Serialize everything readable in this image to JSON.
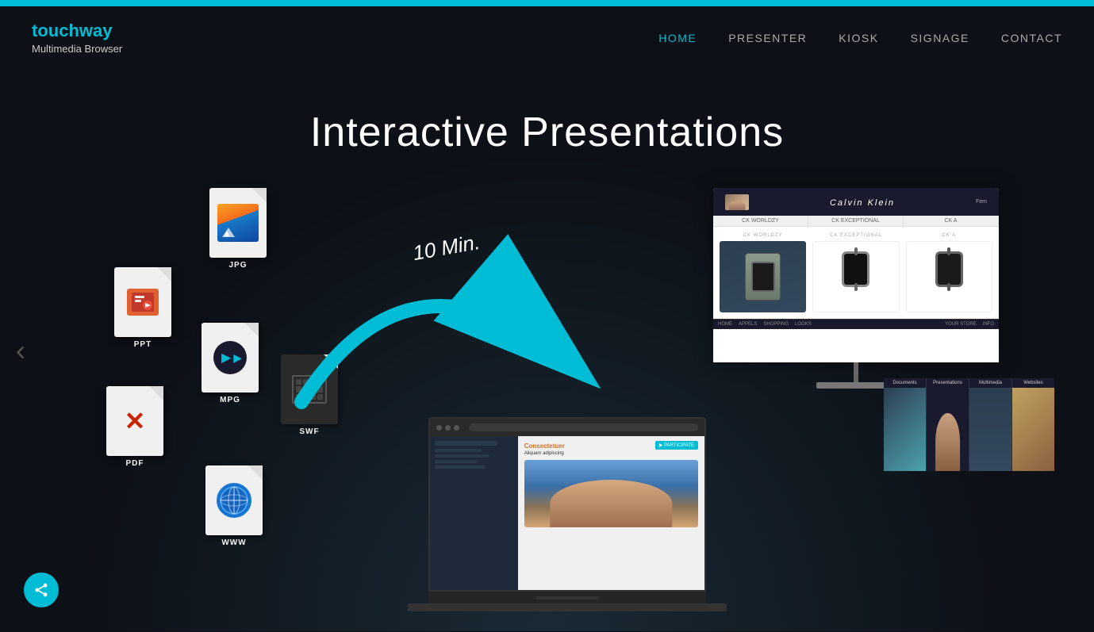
{
  "top_bar": {
    "color": "#00bcd4"
  },
  "header": {
    "logo": {
      "brand_prefix": "touch",
      "brand_suffix": "way",
      "subtitle": "Multimedia Browser"
    },
    "nav": {
      "items": [
        {
          "label": "HOME",
          "active": true
        },
        {
          "label": "PRESENTER",
          "active": false
        },
        {
          "label": "KIOSK",
          "active": false
        },
        {
          "label": "SIGNAGE",
          "active": false
        },
        {
          "label": "CONTACT",
          "active": false
        }
      ]
    }
  },
  "hero": {
    "title": "Interactive Presentations",
    "arrow_label": "10 Min.",
    "files": [
      {
        "type": "PPT",
        "label": "PPT"
      },
      {
        "type": "JPG",
        "label": "JPG"
      },
      {
        "type": "MPG",
        "label": "MPG"
      },
      {
        "type": "PDF",
        "label": "PDF"
      },
      {
        "type": "SWF",
        "label": "SWF"
      },
      {
        "type": "WWW",
        "label": "WWW"
      }
    ]
  },
  "laptop": {
    "heading": "Consectetuer",
    "subheading": "Aliquam adipiscing"
  },
  "monitor": {
    "brand": "Calvin Klein",
    "tabs": [
      "CK WORLDZY",
      "CK EXCEPTIONAL",
      "CK A"
    ],
    "footer_label": "Fem"
  },
  "preview_thumbs": {
    "labels": [
      "Documents",
      "Presentations",
      "Multimedia",
      "Websites"
    ]
  },
  "share_button": {
    "label": "share"
  },
  "nav_arrows": {
    "left": "‹",
    "right": "›"
  }
}
